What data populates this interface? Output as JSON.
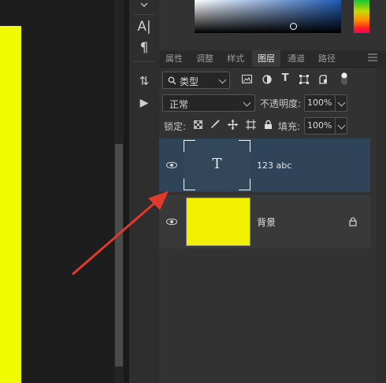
{
  "toolstrip": {
    "tools": [
      {
        "name": "character-tool",
        "glyph": "A|"
      },
      {
        "name": "paragraph-tool",
        "glyph": "¶"
      },
      {
        "name": "timeline-tool",
        "glyph": "⇅"
      },
      {
        "name": "play-tool",
        "glyph": "▶"
      }
    ]
  },
  "panel_tabs": [
    "属性",
    "调整",
    "样式",
    "图层",
    "通道",
    "路径"
  ],
  "active_tab": "图层",
  "filter": {
    "kind_label": "类型",
    "icons": [
      "image-filter-icon",
      "adjustment-filter-icon",
      "type-filter-icon",
      "shape-filter-icon",
      "smartobject-filter-icon",
      "filter-toggle-icon"
    ]
  },
  "blend": {
    "mode": "正常",
    "opacity_label": "不透明度:",
    "opacity_value": "100%"
  },
  "lock": {
    "label": "锁定:",
    "fill_label": "填充:",
    "fill_value": "100%",
    "icons": [
      "lock-pixels-icon",
      "lock-brush-icon",
      "lock-position-icon",
      "lock-artboard-icon",
      "lock-all-icon"
    ]
  },
  "layers": [
    {
      "name": "123 abc",
      "type": "text",
      "selected": true,
      "thumb_glyph": "T"
    },
    {
      "name": "背景",
      "type": "background",
      "locked": true,
      "thumb_color": "#f0f000"
    }
  ],
  "colors": {
    "accent_yellow": "#f0fa00",
    "selected_layer": "#2f4458",
    "arrow": "#e23a2a"
  }
}
